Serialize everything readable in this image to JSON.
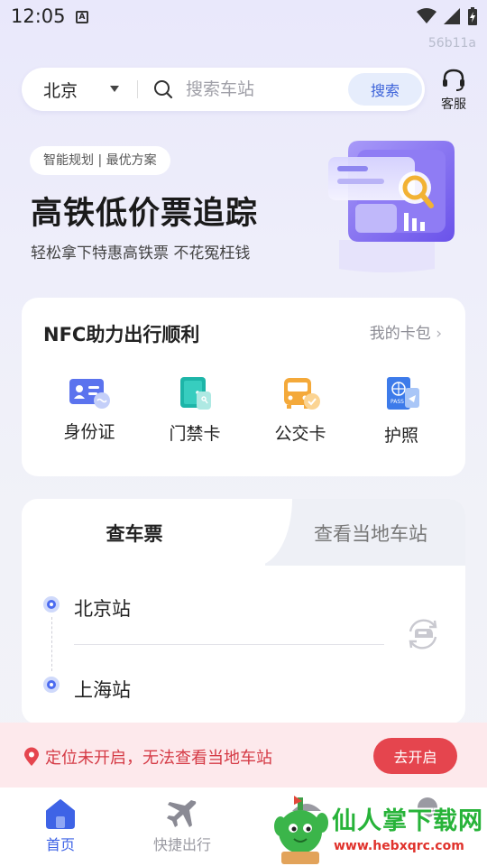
{
  "status_bar": {
    "time": "12:05",
    "notification_icon_letter": "A"
  },
  "build_tag": "56b11a",
  "search": {
    "city": "北京",
    "placeholder": "搜索车站",
    "button_label": "搜索"
  },
  "service": {
    "label": "客服"
  },
  "hero": {
    "tagline": "智能规划 | 最优方案",
    "title": "高铁低价票追踪",
    "subtitle": "轻松拿下特惠高铁票 不花冤枉钱"
  },
  "nfc": {
    "title": "NFC助力出行顺利",
    "wallet_link": "我的卡包",
    "items": [
      {
        "label": "身份证",
        "icon": "id-card-icon"
      },
      {
        "label": "门禁卡",
        "icon": "access-card-icon"
      },
      {
        "label": "公交卡",
        "icon": "bus-card-icon"
      },
      {
        "label": "护照",
        "icon": "passport-icon"
      }
    ]
  },
  "ticket": {
    "tabs": [
      "查车票",
      "查看当地车站"
    ],
    "from_station": "北京站",
    "to_station": "上海站"
  },
  "alert": {
    "text": "定位未开启，无法查看当地车站",
    "button_label": "去开启"
  },
  "nav": {
    "items": [
      {
        "label": "首页"
      },
      {
        "label": "快捷出行"
      }
    ]
  },
  "watermark": {
    "title": "仙人掌下载网",
    "url": "www.hebxqrc.com"
  },
  "colors": {
    "accent": "#3e63e6",
    "alert_red": "#e5454e",
    "alert_bg": "#fde9ec",
    "watermark_green": "#27b339"
  }
}
